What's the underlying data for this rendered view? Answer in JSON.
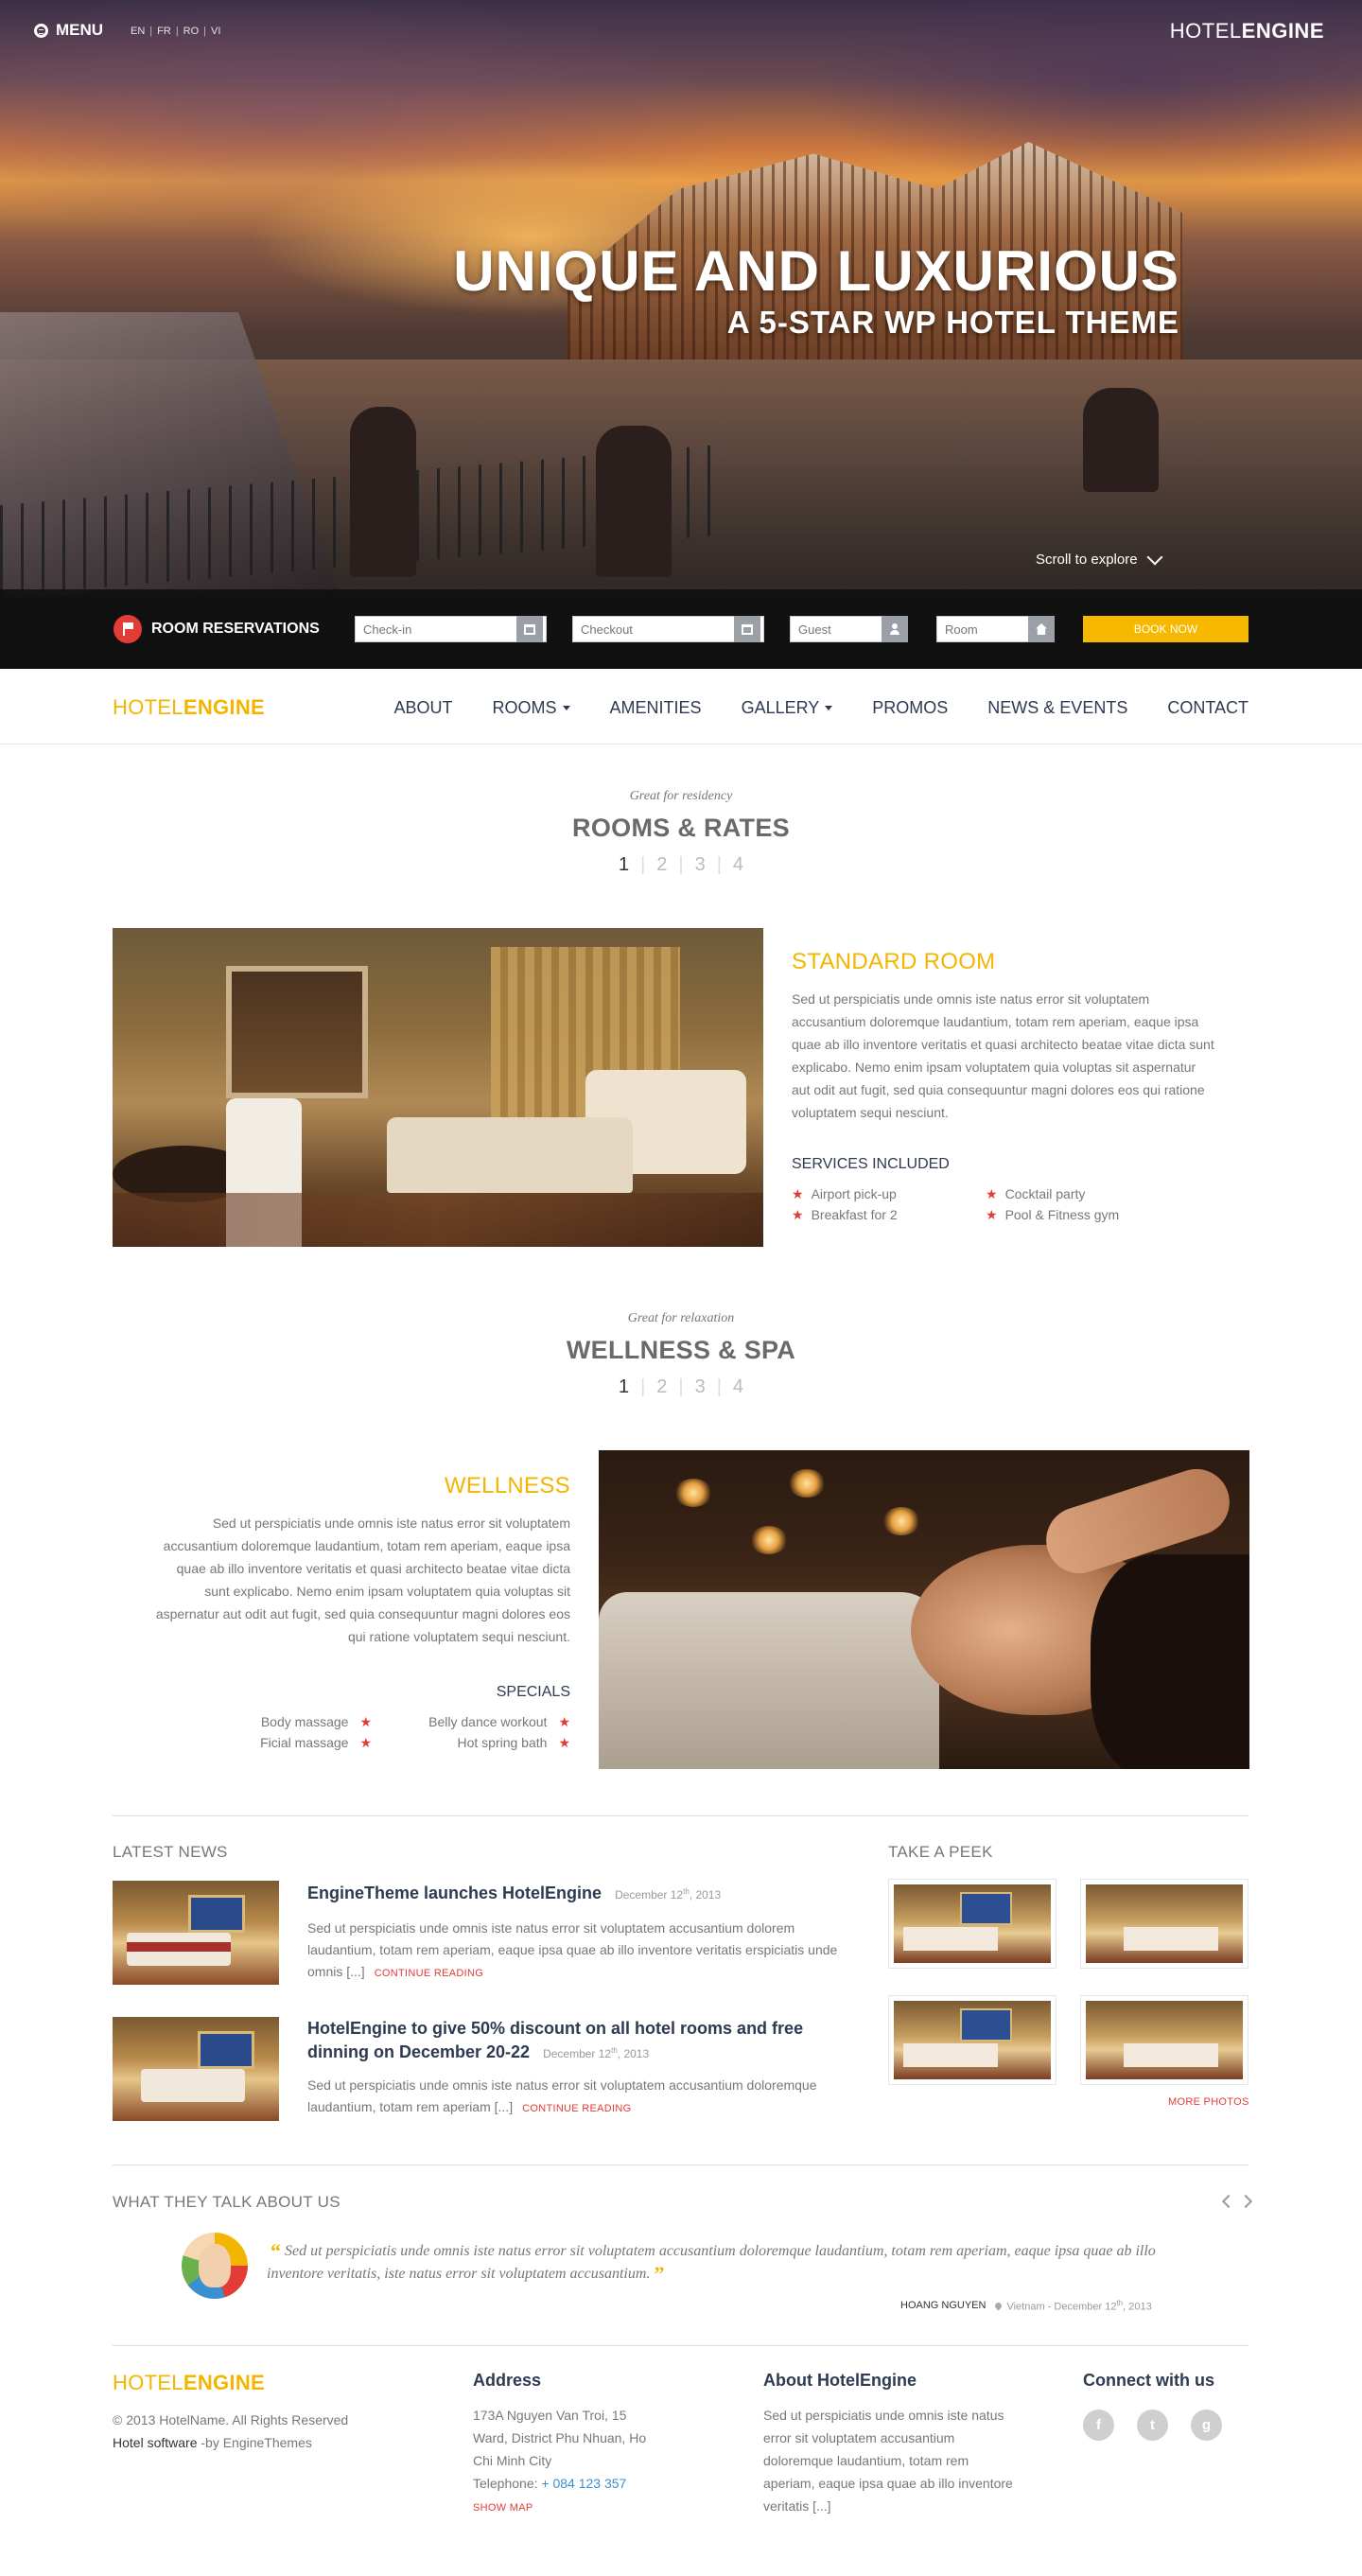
{
  "hero": {
    "menu_label": "MENU",
    "languages": [
      "EN",
      "FR",
      "RO",
      "VI"
    ],
    "logo_light": "HOTEL",
    "logo_bold": "ENGINE",
    "title": "UNIQUE AND LUXURIOUS",
    "subtitle": "A 5-STAR WP HOTEL THEME",
    "scroll_label": "Scroll to explore"
  },
  "booking": {
    "label": "ROOM RESERVATIONS",
    "checkin_placeholder": "Check-in",
    "checkout_placeholder": "Checkout",
    "guest_placeholder": "Guest",
    "room_placeholder": "Room",
    "book_label": "BOOK NOW"
  },
  "nav": {
    "logo_light": "HOTEL",
    "logo_bold": "ENGINE",
    "items": [
      {
        "label": "ABOUT"
      },
      {
        "label": "ROOMS"
      },
      {
        "label": "AMENITIES"
      },
      {
        "label": "GALLERY"
      },
      {
        "label": "PROMOS"
      },
      {
        "label": "NEWS & EVENTS"
      },
      {
        "label": "CONTACT"
      }
    ]
  },
  "rooms": {
    "kicker": "Great for residency",
    "title": "ROOMS & RATES",
    "pages": [
      "1",
      "2",
      "3",
      "4"
    ],
    "room_title": "STANDARD ROOM",
    "room_text": "Sed ut perspiciatis unde omnis iste natus error sit voluptatem accusantium doloremque laudantium, totam rem aperiam, eaque ipsa quae ab illo inventore veritatis et quasi architecto beatae vitae dicta sunt explicabo. Nemo enim ipsam voluptatem quia voluptas sit aspernatur aut odit aut fugit, sed quia consequuntur magni dolores eos qui ratione voluptatem sequi nesciunt.",
    "services_title": "SERVICES INCLUDED",
    "services": [
      "Airport pick-up",
      "Cocktail party",
      "Breakfast for 2",
      "Pool & Fitness gym"
    ]
  },
  "wellness": {
    "kicker": "Great for relaxation",
    "title": "WELLNESS & SPA",
    "pages": [
      "1",
      "2",
      "3",
      "4"
    ],
    "item_title": "WELLNESS",
    "item_text": "Sed ut perspiciatis unde omnis iste natus error sit voluptatem accusantium doloremque laudantium, totam rem aperiam, eaque ipsa quae ab illo inventore veritatis et quasi architecto beatae vitae dicta sunt explicabo. Nemo enim ipsam voluptatem quia voluptas sit aspernatur aut odit aut fugit, sed quia consequuntur magni dolores eos qui ratione voluptatem sequi nesciunt.",
    "specials_title": "SPECIALS",
    "specials": [
      "Body massage",
      "Belly dance workout",
      "Ficial massage",
      "Hot spring bath"
    ]
  },
  "news": {
    "heading": "LATEST NEWS",
    "items": [
      {
        "title": "EngineTheme launches HotelEngine",
        "date_pre": "December 12",
        "date_sup": "th",
        "date_post": ", 2013",
        "text": "Sed ut perspiciatis unde omnis iste natus error sit voluptatem accusantium dolorem laudantium, totam rem aperiam, eaque ipsa quae ab illo inventore veritatis erspiciatis unde omnis [...]",
        "more": "CONTINUE READING"
      },
      {
        "title": "HotelEngine to give 50% discount on all hotel rooms and free dinning on December 20-22",
        "date_pre": "December 12",
        "date_sup": "th",
        "date_post": ", 2013",
        "text": "Sed ut perspiciatis unde omnis iste natus error sit voluptatem accusantium doloremque laudantium, totam rem aperiam [...]",
        "more": "CONTINUE READING"
      }
    ]
  },
  "peek": {
    "heading": "TAKE A PEEK",
    "more": "MORE PHOTOS"
  },
  "testimonial": {
    "heading": "WHAT THEY TALK ABOUT US",
    "quote": "Sed ut perspiciatis unde omnis iste natus error sit voluptatem accusantium doloremque laudantium, totam rem aperiam, eaque ipsa quae ab illo inventore veritatis, iste natus error sit voluptatem accusantium.",
    "author": "HOANG NGUYEN",
    "location_pre": "Vietnam - December 12",
    "location_sup": "th",
    "location_post": ", 2013"
  },
  "footer": {
    "logo_light": "HOTEL",
    "logo_bold": "ENGINE",
    "copyright": "© 2013  HotelName. All Rights Reserved",
    "software_pre": "Hotel software",
    "software_post": " -by EngineThemes",
    "address_title": "Address",
    "address_lines": [
      "173A Nguyen Van Troi, 15",
      "Ward, District Phu Nhuan, Ho",
      "Chi Minh City"
    ],
    "telephone_label": "Telephone: ",
    "telephone": "+ 084 123 357",
    "show_map": "SHOW MAP",
    "about_title": "About HotelEngine",
    "about_text": "Sed ut perspiciatis unde omnis iste natus error sit voluptatem accusantium doloremque laudantium, totam rem aperiam, eaque ipsa quae ab illo inventore veritatis [...]",
    "connect_title": "Connect with us",
    "social": [
      {
        "icon": "facebook-icon",
        "glyph": "f"
      },
      {
        "icon": "twitter-icon",
        "glyph": "t"
      },
      {
        "icon": "google-plus-icon",
        "glyph": "g"
      }
    ]
  }
}
